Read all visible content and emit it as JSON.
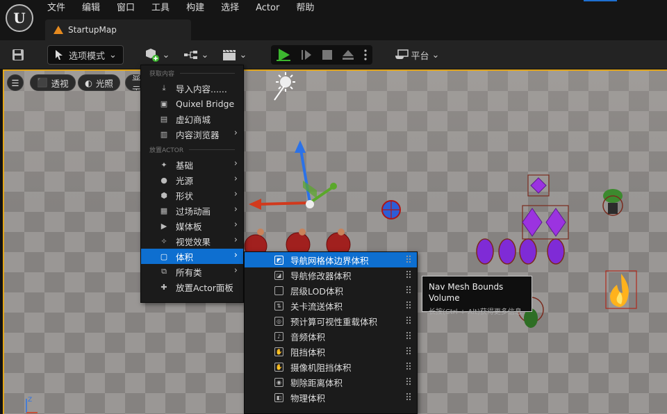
{
  "app": {
    "logo_text": "U"
  },
  "menubar": {
    "items": [
      "文件",
      "编辑",
      "窗口",
      "工具",
      "构建",
      "选择",
      "Actor",
      "帮助"
    ]
  },
  "level_tab": {
    "title": "StartupMap"
  },
  "toolbar": {
    "mode_label": "选项模式",
    "platform_label": "平台"
  },
  "viewport": {
    "buttons": {
      "perspective": "透视",
      "lighting": "光照",
      "show": "显示"
    }
  },
  "create_menu": {
    "section_get": "获取内容",
    "get_items": [
      "导入内容......",
      "Quixel Bridge",
      "虚幻商城",
      "内容浏览器"
    ],
    "section_place": "放置ACTOR",
    "place_items": [
      "基础",
      "光源",
      "形状",
      "过场动画",
      "媒体板",
      "视觉效果",
      "体积",
      "所有类",
      "放置Actor面板"
    ]
  },
  "volume_menu": {
    "items": [
      "导航网格体边界体积",
      "导航修改器体积",
      "层级LOD体积",
      "关卡流送体积",
      "预计算可视性重载体积",
      "音频体积",
      "阻挡体积",
      "摄像机阻挡体积",
      "剔除距离体积",
      "物理体积"
    ]
  },
  "tooltip": {
    "title": "Nav Mesh Bounds Volume",
    "hint": "长按(Ctrl + Alt)获得更多信息"
  },
  "colors": {
    "accent": "#0e6fd0",
    "viewport_border": "#e3a71b",
    "play_green": "#3cb72f"
  }
}
